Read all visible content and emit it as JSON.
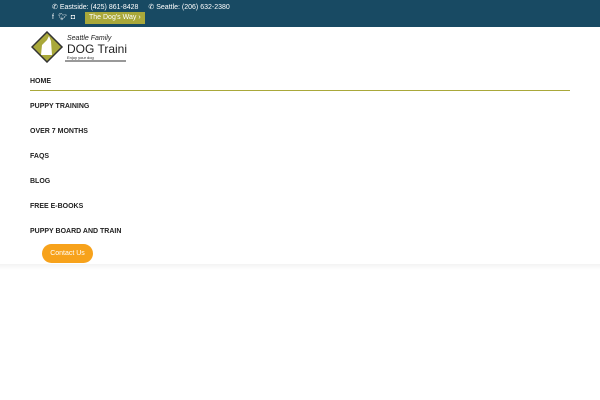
{
  "topbar": {
    "eastside": "Eastside: (425) 861-8428",
    "seattle": "Seattle: (206) 632-2380",
    "dogs_way": "The Dog's Way ›"
  },
  "logo": {
    "line1": "Seattle Family",
    "line2": "DOG Training",
    "tagline": "Enjoy your dog"
  },
  "nav": {
    "items": [
      "HOME",
      "PUPPY TRAINING",
      "OVER 7 MONTHS",
      "FAQS",
      "BLOG",
      "FREE E-BOOKS",
      "PUPPY BOARD AND TRAIN"
    ]
  },
  "contact_label": "Contact Us",
  "colors": {
    "topbar": "#184a63",
    "accent": "#a9a83a",
    "button": "#f7a21b"
  }
}
